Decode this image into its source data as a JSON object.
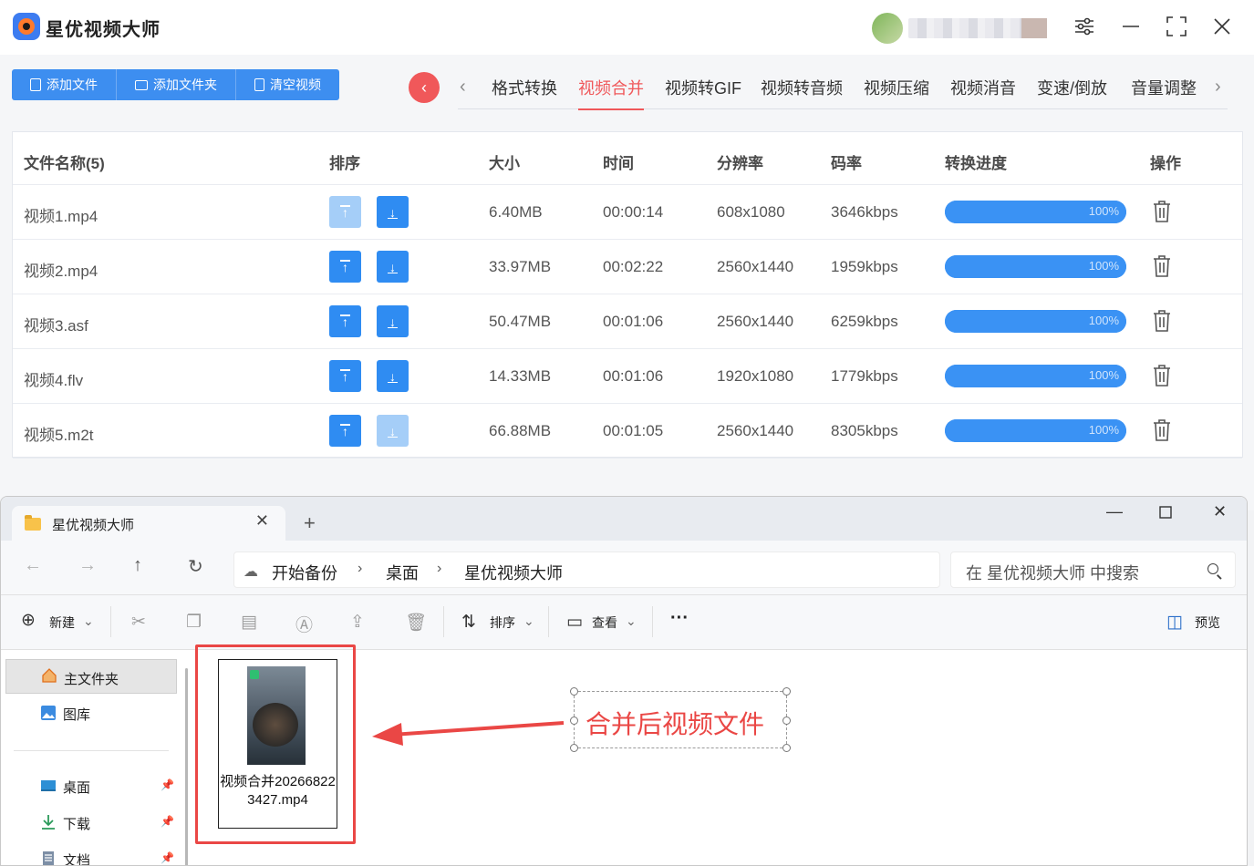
{
  "app": {
    "title": "星优视频大师",
    "buttons": {
      "add_file": "添加文件",
      "add_folder": "添加文件夹",
      "clear": "清空视频"
    },
    "tabs": [
      "格式转换",
      "视频合并",
      "视频转GIF",
      "视频转音频",
      "视频压缩",
      "视频消音",
      "变速/倒放",
      "音量调整"
    ],
    "active_tab": "视频合并",
    "accent": "#f0585a",
    "primary": "#3d8ef0"
  },
  "table": {
    "headers": {
      "name": "文件名称(5)",
      "sort": "排序",
      "size": "大小",
      "time": "时间",
      "res": "分辨率",
      "bitrate": "码率",
      "progress": "转换进度",
      "action": "操作"
    },
    "rows": [
      {
        "name": "视频1.mp4",
        "size": "6.40MB",
        "time": "00:00:14",
        "res": "608x1080",
        "bitrate": "3646kbps",
        "progress": "100%",
        "progress_value": 1.0
      },
      {
        "name": "视频2.mp4",
        "size": "33.97MB",
        "time": "00:02:22",
        "res": "2560x1440",
        "bitrate": "1959kbps",
        "progress": "100%",
        "progress_value": 1.0
      },
      {
        "name": "视频3.asf",
        "size": "50.47MB",
        "time": "00:01:06",
        "res": "2560x1440",
        "bitrate": "6259kbps",
        "progress": "100%",
        "progress_value": 1.0
      },
      {
        "name": "视频4.flv",
        "size": "14.33MB",
        "time": "00:01:06",
        "res": "1920x1080",
        "bitrate": "1779kbps",
        "progress": "100%",
        "progress_value": 1.0
      },
      {
        "name": "视频5.m2t",
        "size": "66.88MB",
        "time": "00:01:05",
        "res": "2560x1440",
        "bitrate": "8305kbps",
        "progress": "100%",
        "progress_value": 1.0
      }
    ]
  },
  "explorer": {
    "tab_title": "星优视频大师",
    "breadcrumb": [
      "开始备份",
      "桌面",
      "星优视频大师"
    ],
    "search_placeholder": "在 星优视频大师 中搜索",
    "commands": {
      "new": "新建",
      "sort": "排序",
      "view": "查看",
      "more": "···",
      "preview": "预览"
    },
    "sidebar": {
      "home": "主文件夹",
      "gallery": "图库",
      "desktop": "桌面",
      "downloads": "下载",
      "documents": "文档"
    },
    "file": {
      "name": "视频合并202668223427.mp4"
    }
  },
  "annotation": {
    "label": "合并后视频文件",
    "color": "#ea4745"
  }
}
